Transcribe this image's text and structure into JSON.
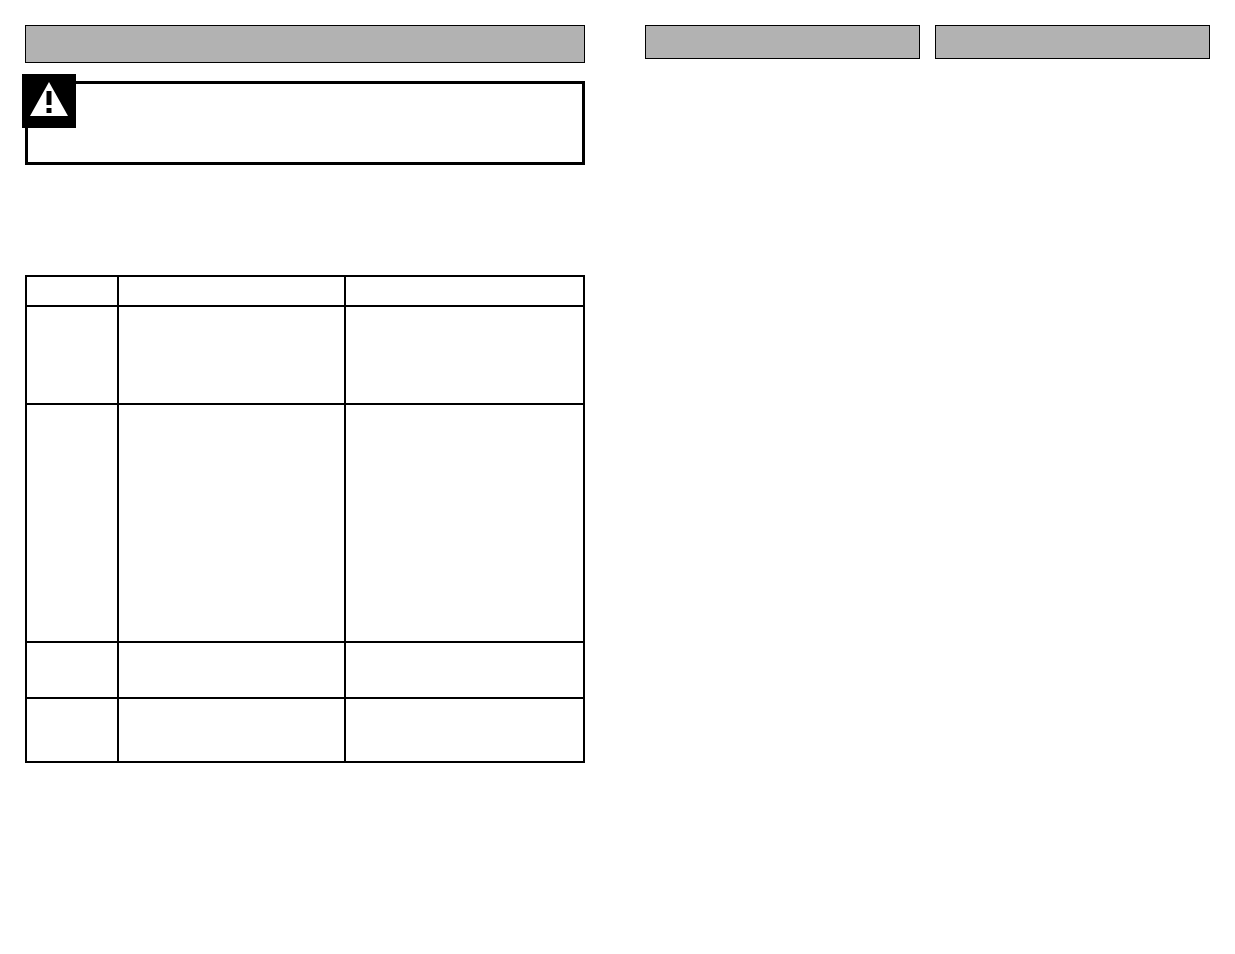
{
  "leftBar": "",
  "rightBars": [
    "",
    ""
  ],
  "warning": {
    "iconName": "warning-icon",
    "text": ""
  },
  "tableHeaders": [
    "",
    "",
    ""
  ],
  "tableRows": [
    [
      "",
      "",
      ""
    ],
    [
      "",
      "",
      ""
    ],
    [
      "",
      "",
      ""
    ],
    [
      "",
      "",
      ""
    ]
  ]
}
